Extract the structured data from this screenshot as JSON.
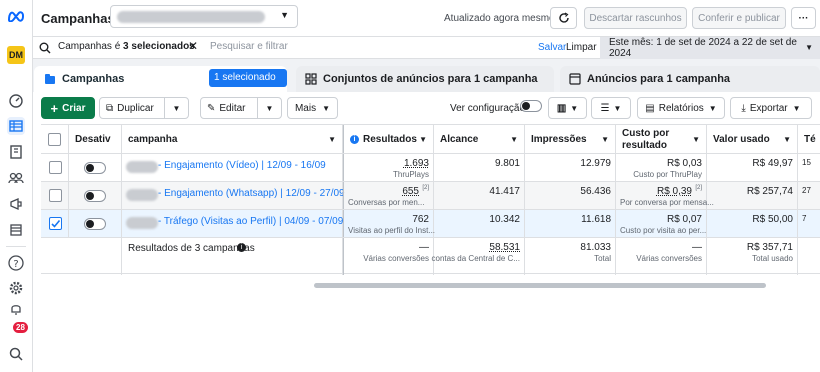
{
  "header": {
    "title": "Campanhas",
    "updated_text": "Atualizado agora mesmo",
    "discard_label": "Descartar rascunhos",
    "review_label": "Conferir e publicar",
    "more_label": "···"
  },
  "filter": {
    "chip_prefix": "Campanhas é ",
    "chip_bold": "3 selecionados",
    "placeholder": "Pesquisar e filtrar",
    "save_label": "Salvar",
    "clear_label": "Limpar",
    "date_range": "Este mês: 1 de set de 2024 a 22 de set de 2024"
  },
  "tabs": {
    "campaigns": "Campanhas",
    "selected_badge": "1 selecionado",
    "adsets": "Conjuntos de anúncios para 1 campanha",
    "ads": "Anúncios para 1 campanha"
  },
  "toolbar": {
    "create": "Criar",
    "duplicate": "Duplicar",
    "edit": "Editar",
    "more": "Mais",
    "view_setup": "Ver configuração",
    "reports": "Relatórios",
    "export": "Exportar"
  },
  "table": {
    "headers": {
      "delivery": "Desativ",
      "campaign": "campanha",
      "results": "Resultados",
      "reach": "Alcance",
      "impressions": "Impressões",
      "cost_line1": "Custo por",
      "cost_line2": "resultado",
      "spent": "Valor usado",
      "ends": "Té"
    },
    "rows": [
      {
        "name": "- Engajamento (Vídeo) | 12/09 - 16/09",
        "results": "1.693",
        "results_sub": "ThruPlays",
        "reach": "9.801",
        "impressions": "12.979",
        "cost": "R$ 0,03",
        "cost_sub": "Custo por ThruPlay",
        "spent": "R$ 49,97",
        "ends": "15"
      },
      {
        "name": "- Engajamento (Whatsapp) | 12/09 - 27/09",
        "results": "655",
        "results_sup": "[2]",
        "results_sub": "Conversas por men...",
        "reach": "41.417",
        "impressions": "56.436",
        "cost": "R$ 0,39",
        "cost_sup": "[2]",
        "cost_sub": "Por conversa por mensa...",
        "spent": "R$ 257,74",
        "ends": "27"
      },
      {
        "name": "- Tráfego (Visitas ao Perfil) | 04/09 - 07/09",
        "results": "762",
        "results_sub": "Visitas ao perfil do Inst...",
        "reach": "10.342",
        "impressions": "11.618",
        "cost": "R$ 0,07",
        "cost_sub": "Custo por visita ao per...",
        "spent": "R$ 50,00",
        "ends": "7"
      }
    ],
    "totals": {
      "label": "Resultados de 3 campanhas",
      "results": "—",
      "results_sub": "Várias conversões",
      "reach": "58.531",
      "reach_sub": "contas da Central de C...",
      "impressions": "81.033",
      "impressions_sub": "Total",
      "cost": "—",
      "cost_sub": "Várias conversões",
      "spent": "R$ 357,71",
      "spent_sub": "Total usado"
    }
  },
  "rail": {
    "notification_count": "28",
    "brand_badge": "DM"
  },
  "colors": {
    "accent": "#1877f2",
    "create_green": "#0a7c4a",
    "badge_red": "#e41e3f"
  }
}
